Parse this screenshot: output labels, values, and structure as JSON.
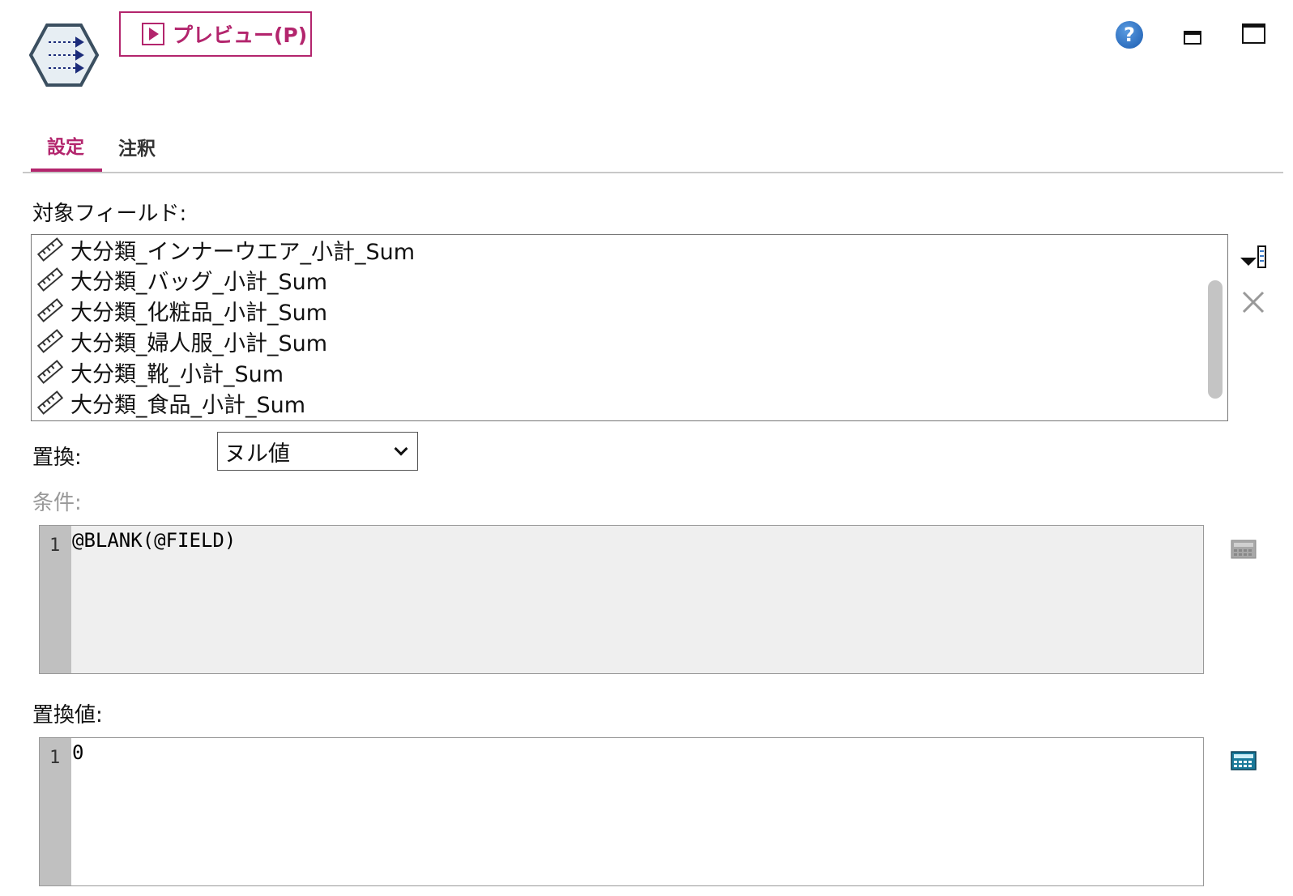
{
  "header": {
    "preview_label": "プレビュー(P)",
    "help_glyph": "?"
  },
  "tabs": [
    {
      "label": "設定",
      "active": true
    },
    {
      "label": "注釈",
      "active": false
    }
  ],
  "target_fields": {
    "label": "対象フィールド:",
    "items": [
      "大分類_インナーウエア_小計_Sum",
      "大分類_バッグ_小計_Sum",
      "大分類_化粧品_小計_Sum",
      "大分類_婦人服_小計_Sum",
      "大分類_靴_小計_Sum",
      "大分類_食品_小計_Sum"
    ]
  },
  "replace": {
    "label": "置換:",
    "selected": "ヌル値"
  },
  "condition": {
    "label": "条件:",
    "line_number": "1",
    "code": "@BLANK(@FIELD)"
  },
  "replace_value": {
    "label": "置換値:",
    "line_number": "1",
    "code": "0"
  },
  "colors": {
    "accent": "#b3256d"
  }
}
